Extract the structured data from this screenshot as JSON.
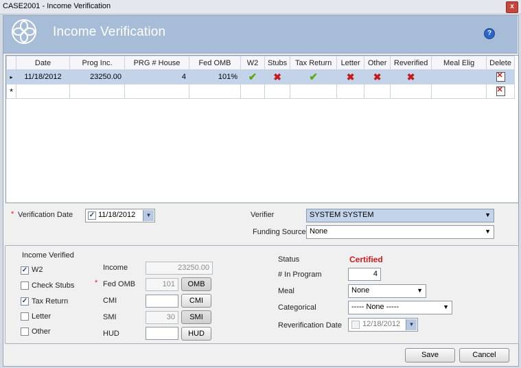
{
  "window": {
    "title": "CASE2001 - Income Verification",
    "close": "x"
  },
  "header": {
    "title": "Income Verification",
    "help": "?"
  },
  "grid": {
    "columns": [
      "Date",
      "Prog Inc.",
      "PRG # House",
      "Fed OMB",
      "W2",
      "Stubs",
      "Tax Return",
      "Letter",
      "Other",
      "Reverified",
      "Meal Elig",
      "Delete"
    ],
    "row": {
      "date": "11/18/2012",
      "prog_inc": "23250.00",
      "prg_house": "4",
      "fed_omb": "101%",
      "w2": "check",
      "stubs": "x",
      "tax_return": "check",
      "letter": "x",
      "other": "x",
      "reverified": "x",
      "meal_elig": "",
      "delete": "delete-icon"
    },
    "new_row_marker": "*",
    "current_row_marker": "▸"
  },
  "verification": {
    "date_label": "Verification Date",
    "date_value": "11/18/2012",
    "date_checked": true,
    "verifier_label": "Verifier",
    "verifier_value": "SYSTEM  SYSTEM",
    "funding_label": "Funding Source",
    "funding_value": "None"
  },
  "income_verified": {
    "title": "Income Verified",
    "items": [
      {
        "label": "W2",
        "checked": true
      },
      {
        "label": "Check Stubs",
        "checked": false
      },
      {
        "label": "Tax Return",
        "checked": true
      },
      {
        "label": "Letter",
        "checked": false
      },
      {
        "label": "Other",
        "checked": false
      }
    ]
  },
  "amounts": {
    "income_label": "Income",
    "income_value": "23250.00",
    "fed_omb_label": "Fed OMB",
    "fed_omb_value": "101",
    "omb_button": "OMB",
    "cmi_label": "CMI",
    "cmi_value": "",
    "cmi_button": "CMI",
    "smi_label": "SMI",
    "smi_value": "30",
    "smi_button": "SMI",
    "hud_label": "HUD",
    "hud_value": "",
    "hud_button": "HUD"
  },
  "status": {
    "status_label": "Status",
    "status_value": "Certified",
    "in_program_label": "# In Program",
    "in_program_value": "4",
    "meal_label": "Meal",
    "meal_value": "None",
    "categorical_label": "Categorical",
    "categorical_value": "----- None -----",
    "reverification_label": "Reverification Date",
    "reverification_value": "12/18/2012"
  },
  "footer": {
    "save": "Save",
    "cancel": "Cancel"
  },
  "colors": {
    "header": "#a7bcd7",
    "selected_row": "#c3d3ea",
    "status": "#d01b1b"
  }
}
